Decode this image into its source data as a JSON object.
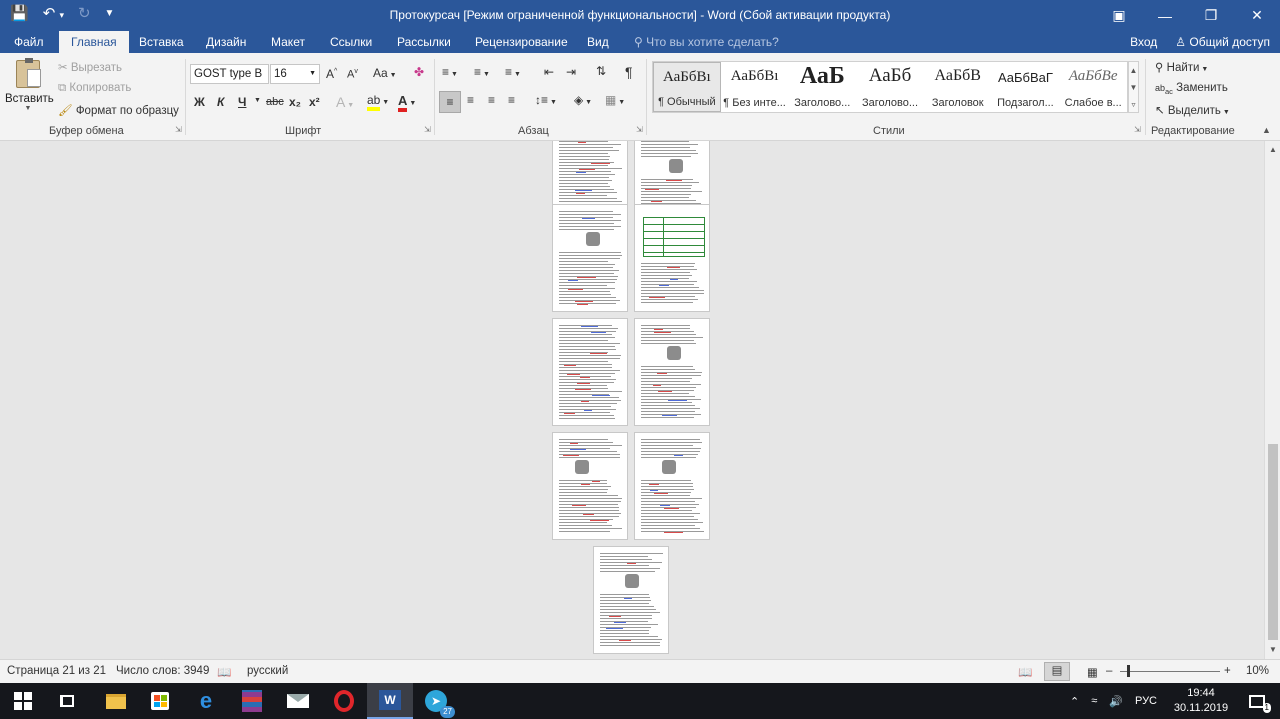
{
  "window": {
    "title": "Протокурсач [Режим ограниченной функциональности] - Word (Сбой активации продукта)",
    "qat": {
      "save_icon": "save-icon",
      "undo_icon": "undo-icon",
      "redo_icon": "redo-icon",
      "customize_icon": "customize-qat-icon"
    },
    "controls": {
      "ribbon_display": "ribbon-display-options-icon",
      "restore": "restore-icon",
      "close": "close-icon"
    }
  },
  "tabs": [
    {
      "label": "Файл"
    },
    {
      "label": "Главная"
    },
    {
      "label": "Вставка"
    },
    {
      "label": "Дизайн"
    },
    {
      "label": "Макет"
    },
    {
      "label": "Ссылки"
    },
    {
      "label": "Рассылки"
    },
    {
      "label": "Рецензирование"
    },
    {
      "label": "Вид"
    }
  ],
  "tell_me": {
    "placeholder": "Что вы хотите сделать?"
  },
  "account": {
    "sign_in": "Вход",
    "share": "Общий доступ"
  },
  "clipboard": {
    "paste": "Вставить",
    "cut": "Вырезать",
    "copy": "Копировать",
    "format_painter": "Формат по образцу",
    "group_label": "Буфер обмена"
  },
  "font": {
    "name": "GOST type B",
    "size": "16",
    "bold": "Ж",
    "italic": "К",
    "underline": "Ч",
    "strikethrough": "abc",
    "subscript": "x₂",
    "superscript": "x²",
    "change_case": "Aa",
    "group_label": "Шрифт"
  },
  "paragraph": {
    "group_label": "Абзац",
    "pilcrow": "¶"
  },
  "styles": {
    "group_label": "Стили",
    "items": [
      {
        "preview": "АаБбВı",
        "name": "¶ Обычный"
      },
      {
        "preview": "АаБбВı",
        "name": "¶ Без инте..."
      },
      {
        "preview": "АаБ",
        "name": "Заголово..."
      },
      {
        "preview": "АаБб",
        "name": "Заголово..."
      },
      {
        "preview": "АаБбВ",
        "name": "Заголовок"
      },
      {
        "preview": "АаБбВаГ",
        "name": "Подзагол..."
      },
      {
        "preview": "АаБбВе",
        "name": "Слабое в..."
      }
    ]
  },
  "editing": {
    "find": "Найти",
    "replace": "Заменить",
    "select": "Выделить",
    "group_label": "Редактирование"
  },
  "status": {
    "page": "Страница 21 из 21",
    "words": "Число слов: 3949",
    "language": "русский",
    "zoom": "10%",
    "zoom_level": 0.1
  },
  "taskbar": {
    "apps": [
      "start-icon",
      "task-view-icon",
      "file-explorer-icon",
      "store-icon",
      "edge-icon",
      "winrar-icon",
      "mail-icon",
      "opera-icon",
      "word-icon",
      "telegram-icon"
    ],
    "telegram_badge": "27",
    "language": "РУС",
    "time": "19:44",
    "date": "30.11.2019",
    "notifications": "1"
  }
}
